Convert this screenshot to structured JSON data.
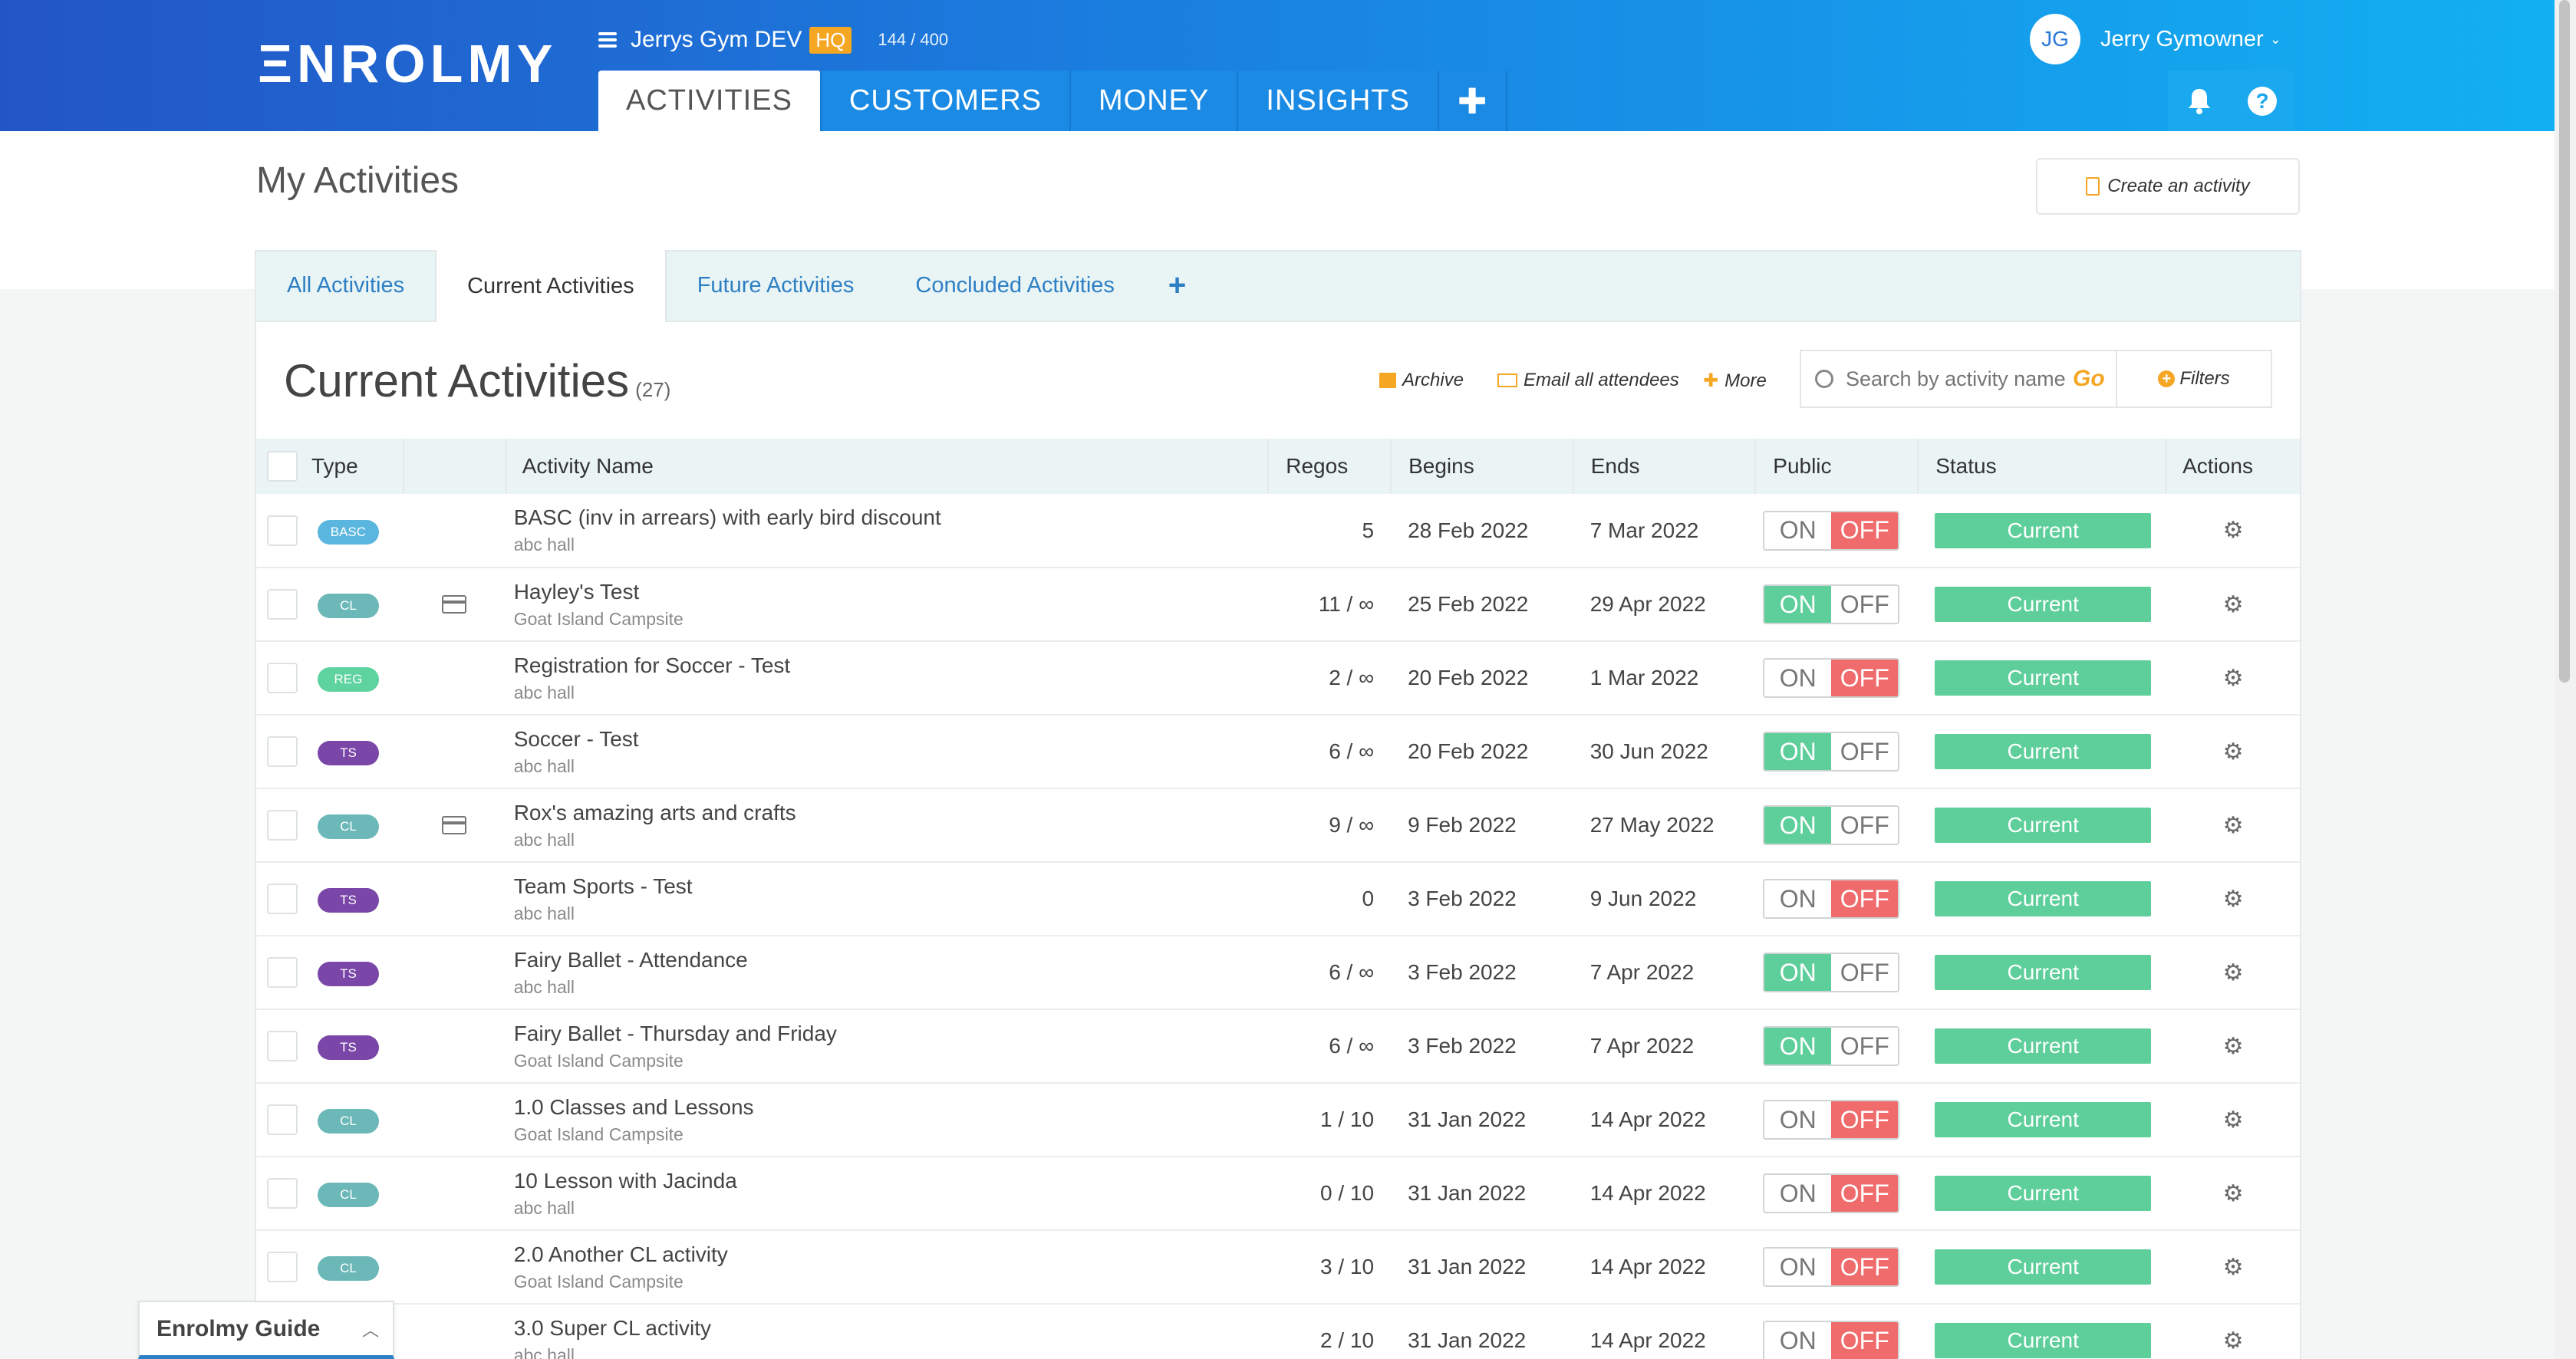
{
  "header": {
    "logo_text": "ΞNROLMY",
    "org_name": "Jerrys Gym DEV",
    "org_badge": "HQ",
    "quota": "144 / 400",
    "nav_tabs": [
      "ACTIVITIES",
      "CUSTOMERS",
      "MONEY",
      "INSIGHTS"
    ],
    "nav_plus": "✚",
    "user_initials": "JG",
    "user_name": "Jerry Gymowner"
  },
  "page": {
    "title": "My Activities",
    "create_label": "Create an activity"
  },
  "subtabs": [
    "All Activities",
    "Current Activities",
    "Future Activities",
    "Concluded Activities"
  ],
  "subtabs_plus": "+",
  "section": {
    "title": "Current Activities",
    "count": "(27)"
  },
  "toolbar": {
    "archive": "Archive",
    "email": "Email all attendees",
    "more": "More",
    "search_placeholder": "Search by activity name",
    "go": "Go",
    "filters": "Filters"
  },
  "table": {
    "columns": [
      "Type",
      "Activity Name",
      "Regos",
      "Begins",
      "Ends",
      "Public",
      "Status",
      "Actions"
    ],
    "toggle_on": "ON",
    "toggle_off": "OFF",
    "rows": [
      {
        "type": "BASC",
        "type_color": "#5bb6df",
        "card": false,
        "name": "BASC (inv in arrears) with early bird discount",
        "venue": "abc hall",
        "regos": "5",
        "begins": "28 Feb 2022",
        "ends": "7 Mar 2022",
        "public": false,
        "status": "Current"
      },
      {
        "type": "CL",
        "type_color": "#6cb8b8",
        "card": true,
        "name": "Hayley's Test",
        "venue": "Goat Island Campsite",
        "regos": "11 / ∞",
        "begins": "25 Feb 2022",
        "ends": "29 Apr 2022",
        "public": true,
        "status": "Current"
      },
      {
        "type": "REG",
        "type_color": "#5ed3a0",
        "card": false,
        "name": "Registration for Soccer - Test",
        "venue": "abc hall",
        "regos": "2 / ∞",
        "begins": "20 Feb 2022",
        "ends": "1 Mar 2022",
        "public": false,
        "status": "Current"
      },
      {
        "type": "TS",
        "type_color": "#7a47a8",
        "card": false,
        "name": "Soccer - Test",
        "venue": "abc hall",
        "regos": "6 / ∞",
        "begins": "20 Feb 2022",
        "ends": "30 Jun 2022",
        "public": true,
        "status": "Current"
      },
      {
        "type": "CL",
        "type_color": "#6cb8b8",
        "card": true,
        "name": "Rox's amazing arts and crafts",
        "venue": "abc hall",
        "regos": "9 / ∞",
        "begins": "9 Feb 2022",
        "ends": "27 May 2022",
        "public": true,
        "status": "Current"
      },
      {
        "type": "TS",
        "type_color": "#7a47a8",
        "card": false,
        "name": "Team Sports - Test",
        "venue": "abc hall",
        "regos": "0",
        "begins": "3 Feb 2022",
        "ends": "9 Jun 2022",
        "public": false,
        "status": "Current"
      },
      {
        "type": "TS",
        "type_color": "#7a47a8",
        "card": false,
        "name": "Fairy Ballet - Attendance",
        "venue": "abc hall",
        "regos": "6 / ∞",
        "begins": "3 Feb 2022",
        "ends": "7 Apr 2022",
        "public": true,
        "status": "Current"
      },
      {
        "type": "TS",
        "type_color": "#7a47a8",
        "card": false,
        "name": "Fairy Ballet - Thursday and Friday",
        "venue": "Goat Island Campsite",
        "regos": "6 / ∞",
        "begins": "3 Feb 2022",
        "ends": "7 Apr 2022",
        "public": true,
        "status": "Current"
      },
      {
        "type": "CL",
        "type_color": "#6cb8b8",
        "card": false,
        "name": "1.0 Classes and Lessons",
        "venue": "Goat Island Campsite",
        "regos": "1 / 10",
        "begins": "31 Jan 2022",
        "ends": "14 Apr 2022",
        "public": false,
        "status": "Current"
      },
      {
        "type": "CL",
        "type_color": "#6cb8b8",
        "card": false,
        "name": "10 Lesson with Jacinda",
        "venue": "abc hall",
        "regos": "0 / 10",
        "begins": "31 Jan 2022",
        "ends": "14 Apr 2022",
        "public": false,
        "status": "Current"
      },
      {
        "type": "CL",
        "type_color": "#6cb8b8",
        "card": false,
        "name": "2.0 Another CL activity",
        "venue": "Goat Island Campsite",
        "regos": "3 / 10",
        "begins": "31 Jan 2022",
        "ends": "14 Apr 2022",
        "public": false,
        "status": "Current"
      },
      {
        "type": "CL",
        "type_color": "#6cb8b8",
        "card": false,
        "name": "3.0 Super CL activity",
        "venue": "abc hall",
        "regos": "2 / 10",
        "begins": "31 Jan 2022",
        "ends": "14 Apr 2022",
        "public": false,
        "status": "Current"
      }
    ]
  },
  "guide": {
    "label": "Enrolmy Guide"
  },
  "colors": {
    "accent_orange": "#f5a623",
    "on_green": "#5ecf9b",
    "off_red": "#f06b6b",
    "link_blue": "#2d7fc4"
  }
}
